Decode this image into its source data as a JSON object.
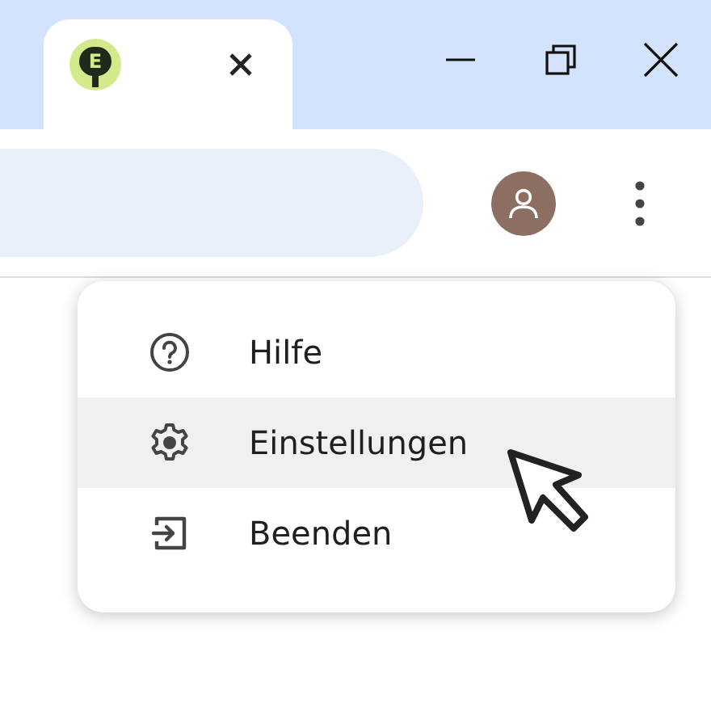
{
  "tab": {
    "logo_text": "E",
    "selected": true
  },
  "menu": {
    "items": [
      {
        "kind": "help",
        "label": "Hilfe",
        "highlighted": false
      },
      {
        "kind": "settings",
        "label": "Einstellungen",
        "highlighted": true
      },
      {
        "kind": "exit",
        "label": "Beenden",
        "highlighted": false
      }
    ]
  }
}
